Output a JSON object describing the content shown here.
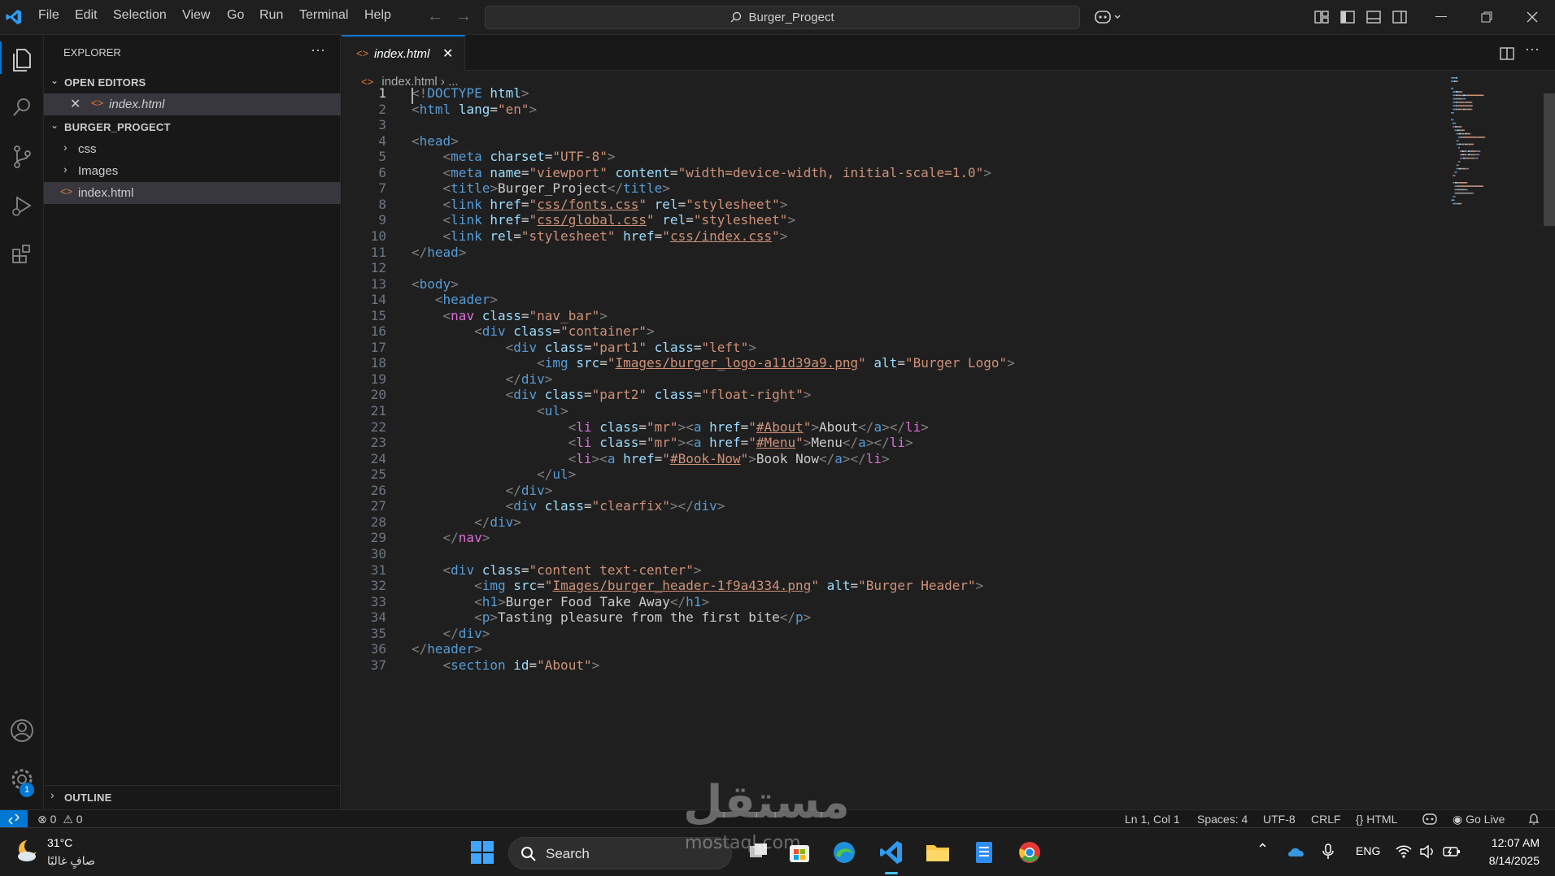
{
  "menu": [
    "File",
    "Edit",
    "Selection",
    "View",
    "Go",
    "Run",
    "Terminal",
    "Help"
  ],
  "search": {
    "label": "Burger_Progect"
  },
  "explorer": {
    "title": "EXPLORER",
    "open_editors_label": "OPEN EDITORS",
    "open_editor_file": "index.html",
    "project_label": "BURGER_PROGECT",
    "folders": [
      "css",
      "Images"
    ],
    "file": "index.html",
    "outline_label": "OUTLINE"
  },
  "tab": {
    "label": "index.html"
  },
  "breadcrumb": {
    "file": "index.html",
    "sep": "›",
    "more": "..."
  },
  "code": [
    [
      [
        "t",
        "<!"
      ],
      [
        "n",
        "DOCTYPE"
      ],
      [
        "x",
        " "
      ],
      [
        "a",
        "html"
      ],
      [
        "t",
        ">"
      ]
    ],
    [
      [
        "t",
        "<"
      ],
      [
        "n",
        "html"
      ],
      [
        "x",
        " "
      ],
      [
        "a",
        "lang"
      ],
      [
        "x",
        "="
      ],
      [
        "s",
        "\"en\""
      ],
      [
        "t",
        ">"
      ]
    ],
    [],
    [
      [
        "t",
        "<"
      ],
      [
        "n",
        "head"
      ],
      [
        "t",
        ">"
      ]
    ],
    [
      [
        "x",
        "    "
      ],
      [
        "t",
        "<"
      ],
      [
        "n",
        "meta"
      ],
      [
        "x",
        " "
      ],
      [
        "a",
        "charset"
      ],
      [
        "x",
        "="
      ],
      [
        "s",
        "\"UTF-8\""
      ],
      [
        "t",
        ">"
      ]
    ],
    [
      [
        "x",
        "    "
      ],
      [
        "t",
        "<"
      ],
      [
        "n",
        "meta"
      ],
      [
        "x",
        " "
      ],
      [
        "a",
        "name"
      ],
      [
        "x",
        "="
      ],
      [
        "s",
        "\"viewport\""
      ],
      [
        "x",
        " "
      ],
      [
        "a",
        "content"
      ],
      [
        "x",
        "="
      ],
      [
        "s",
        "\"width=device-width, initial-scale=1.0\""
      ],
      [
        "t",
        ">"
      ]
    ],
    [
      [
        "x",
        "    "
      ],
      [
        "t",
        "<"
      ],
      [
        "n",
        "title"
      ],
      [
        "t",
        ">"
      ],
      [
        "x",
        "Burger_Project"
      ],
      [
        "t",
        "</"
      ],
      [
        "n",
        "title"
      ],
      [
        "t",
        ">"
      ]
    ],
    [
      [
        "x",
        "    "
      ],
      [
        "t",
        "<"
      ],
      [
        "n",
        "link"
      ],
      [
        "x",
        " "
      ],
      [
        "a",
        "href"
      ],
      [
        "x",
        "="
      ],
      [
        "s",
        "\""
      ],
      [
        "su",
        "css/fonts.css"
      ],
      [
        "s",
        "\""
      ],
      [
        "x",
        " "
      ],
      [
        "a",
        "rel"
      ],
      [
        "x",
        "="
      ],
      [
        "s",
        "\"stylesheet\""
      ],
      [
        "t",
        ">"
      ]
    ],
    [
      [
        "x",
        "    "
      ],
      [
        "t",
        "<"
      ],
      [
        "n",
        "link"
      ],
      [
        "x",
        " "
      ],
      [
        "a",
        "href"
      ],
      [
        "x",
        "="
      ],
      [
        "s",
        "\""
      ],
      [
        "su",
        "css/global.css"
      ],
      [
        "s",
        "\""
      ],
      [
        "x",
        " "
      ],
      [
        "a",
        "rel"
      ],
      [
        "x",
        "="
      ],
      [
        "s",
        "\"stylesheet\""
      ],
      [
        "t",
        ">"
      ]
    ],
    [
      [
        "x",
        "    "
      ],
      [
        "t",
        "<"
      ],
      [
        "n",
        "link"
      ],
      [
        "x",
        " "
      ],
      [
        "a",
        "rel"
      ],
      [
        "x",
        "="
      ],
      [
        "s",
        "\"stylesheet\""
      ],
      [
        "x",
        " "
      ],
      [
        "a",
        "href"
      ],
      [
        "x",
        "="
      ],
      [
        "s",
        "\""
      ],
      [
        "su",
        "css/index.css"
      ],
      [
        "s",
        "\""
      ],
      [
        "t",
        ">"
      ]
    ],
    [
      [
        "t",
        "</"
      ],
      [
        "n",
        "head"
      ],
      [
        "t",
        ">"
      ]
    ],
    [],
    [
      [
        "t",
        "<"
      ],
      [
        "n",
        "body"
      ],
      [
        "t",
        ">"
      ]
    ],
    [
      [
        "x",
        "   "
      ],
      [
        "t",
        "<"
      ],
      [
        "n",
        "header"
      ],
      [
        "t",
        ">"
      ]
    ],
    [
      [
        "x",
        "    "
      ],
      [
        "t",
        "<"
      ],
      [
        "c1",
        "nav"
      ],
      [
        "x",
        " "
      ],
      [
        "a",
        "class"
      ],
      [
        "x",
        "="
      ],
      [
        "s",
        "\"nav_bar\""
      ],
      [
        "t",
        ">"
      ]
    ],
    [
      [
        "x",
        "        "
      ],
      [
        "t",
        "<"
      ],
      [
        "n",
        "div"
      ],
      [
        "x",
        " "
      ],
      [
        "a",
        "class"
      ],
      [
        "x",
        "="
      ],
      [
        "s",
        "\"container\""
      ],
      [
        "t",
        ">"
      ]
    ],
    [
      [
        "x",
        "            "
      ],
      [
        "t",
        "<"
      ],
      [
        "n",
        "div"
      ],
      [
        "x",
        " "
      ],
      [
        "a",
        "class"
      ],
      [
        "x",
        "="
      ],
      [
        "s",
        "\"part1\""
      ],
      [
        "x",
        " "
      ],
      [
        "a",
        "class"
      ],
      [
        "x",
        "="
      ],
      [
        "s",
        "\"left\""
      ],
      [
        "t",
        ">"
      ]
    ],
    [
      [
        "x",
        "                "
      ],
      [
        "t",
        "<"
      ],
      [
        "n",
        "img"
      ],
      [
        "x",
        " "
      ],
      [
        "a",
        "src"
      ],
      [
        "x",
        "="
      ],
      [
        "s",
        "\""
      ],
      [
        "su",
        "Images/burger_logo-a11d39a9.png"
      ],
      [
        "s",
        "\""
      ],
      [
        "x",
        " "
      ],
      [
        "a",
        "alt"
      ],
      [
        "x",
        "="
      ],
      [
        "s",
        "\"Burger Logo\""
      ],
      [
        "t",
        ">"
      ]
    ],
    [
      [
        "x",
        "            "
      ],
      [
        "t",
        "</"
      ],
      [
        "n",
        "div"
      ],
      [
        "t",
        ">"
      ]
    ],
    [
      [
        "x",
        "            "
      ],
      [
        "t",
        "<"
      ],
      [
        "n",
        "div"
      ],
      [
        "x",
        " "
      ],
      [
        "a",
        "class"
      ],
      [
        "x",
        "="
      ],
      [
        "s",
        "\"part2\""
      ],
      [
        "x",
        " "
      ],
      [
        "a",
        "class"
      ],
      [
        "x",
        "="
      ],
      [
        "s",
        "\"float-right\""
      ],
      [
        "t",
        ">"
      ]
    ],
    [
      [
        "x",
        "                "
      ],
      [
        "t",
        "<"
      ],
      [
        "n",
        "ul"
      ],
      [
        "t",
        ">"
      ]
    ],
    [
      [
        "x",
        "                    "
      ],
      [
        "t",
        "<"
      ],
      [
        "c1",
        "li"
      ],
      [
        "x",
        " "
      ],
      [
        "a",
        "class"
      ],
      [
        "x",
        "="
      ],
      [
        "s",
        "\"mr\""
      ],
      [
        "t",
        ">"
      ],
      [
        "t",
        "<"
      ],
      [
        "n",
        "a"
      ],
      [
        "x",
        " "
      ],
      [
        "a",
        "href"
      ],
      [
        "x",
        "="
      ],
      [
        "s",
        "\""
      ],
      [
        "su",
        "#About"
      ],
      [
        "s",
        "\""
      ],
      [
        "t",
        ">"
      ],
      [
        "x",
        "About"
      ],
      [
        "t",
        "</"
      ],
      [
        "n",
        "a"
      ],
      [
        "t",
        "></"
      ],
      [
        "c1",
        "li"
      ],
      [
        "t",
        ">"
      ]
    ],
    [
      [
        "x",
        "                    "
      ],
      [
        "t",
        "<"
      ],
      [
        "c1",
        "li"
      ],
      [
        "x",
        " "
      ],
      [
        "a",
        "class"
      ],
      [
        "x",
        "="
      ],
      [
        "s",
        "\"mr\""
      ],
      [
        "t",
        ">"
      ],
      [
        "t",
        "<"
      ],
      [
        "n",
        "a"
      ],
      [
        "x",
        " "
      ],
      [
        "a",
        "href"
      ],
      [
        "x",
        "="
      ],
      [
        "s",
        "\""
      ],
      [
        "su",
        "#Menu"
      ],
      [
        "s",
        "\""
      ],
      [
        "t",
        ">"
      ],
      [
        "x",
        "Menu"
      ],
      [
        "t",
        "</"
      ],
      [
        "n",
        "a"
      ],
      [
        "t",
        "></"
      ],
      [
        "c1",
        "li"
      ],
      [
        "t",
        ">"
      ]
    ],
    [
      [
        "x",
        "                    "
      ],
      [
        "t",
        "<"
      ],
      [
        "c1",
        "li"
      ],
      [
        "t",
        ">"
      ],
      [
        "t",
        "<"
      ],
      [
        "n",
        "a"
      ],
      [
        "x",
        " "
      ],
      [
        "a",
        "href"
      ],
      [
        "x",
        "="
      ],
      [
        "s",
        "\""
      ],
      [
        "su",
        "#Book-Now"
      ],
      [
        "s",
        "\""
      ],
      [
        "t",
        ">"
      ],
      [
        "x",
        "Book Now"
      ],
      [
        "t",
        "</"
      ],
      [
        "n",
        "a"
      ],
      [
        "t",
        "></"
      ],
      [
        "c1",
        "li"
      ],
      [
        "t",
        ">"
      ]
    ],
    [
      [
        "x",
        "                "
      ],
      [
        "t",
        "</"
      ],
      [
        "n",
        "ul"
      ],
      [
        "t",
        ">"
      ]
    ],
    [
      [
        "x",
        "            "
      ],
      [
        "t",
        "</"
      ],
      [
        "n",
        "div"
      ],
      [
        "t",
        ">"
      ]
    ],
    [
      [
        "x",
        "            "
      ],
      [
        "t",
        "<"
      ],
      [
        "n",
        "div"
      ],
      [
        "x",
        " "
      ],
      [
        "a",
        "class"
      ],
      [
        "x",
        "="
      ],
      [
        "s",
        "\"clearfix\""
      ],
      [
        "t",
        "></"
      ],
      [
        "n",
        "div"
      ],
      [
        "t",
        ">"
      ]
    ],
    [
      [
        "x",
        "        "
      ],
      [
        "t",
        "</"
      ],
      [
        "n",
        "div"
      ],
      [
        "t",
        ">"
      ]
    ],
    [
      [
        "x",
        "    "
      ],
      [
        "t",
        "</"
      ],
      [
        "c1",
        "nav"
      ],
      [
        "t",
        ">"
      ]
    ],
    [],
    [
      [
        "x",
        "    "
      ],
      [
        "t",
        "<"
      ],
      [
        "n",
        "div"
      ],
      [
        "x",
        " "
      ],
      [
        "a",
        "class"
      ],
      [
        "x",
        "="
      ],
      [
        "s",
        "\"content text-center\""
      ],
      [
        "t",
        ">"
      ]
    ],
    [
      [
        "x",
        "        "
      ],
      [
        "t",
        "<"
      ],
      [
        "n",
        "img"
      ],
      [
        "x",
        " "
      ],
      [
        "a",
        "src"
      ],
      [
        "x",
        "="
      ],
      [
        "s",
        "\""
      ],
      [
        "su",
        "Images/burger_header-1f9a4334.png"
      ],
      [
        "s",
        "\""
      ],
      [
        "x",
        " "
      ],
      [
        "a",
        "alt"
      ],
      [
        "x",
        "="
      ],
      [
        "s",
        "\"Burger Header\""
      ],
      [
        "t",
        ">"
      ]
    ],
    [
      [
        "x",
        "        "
      ],
      [
        "t",
        "<"
      ],
      [
        "n",
        "h1"
      ],
      [
        "t",
        ">"
      ],
      [
        "x",
        "Burger Food Take Away"
      ],
      [
        "t",
        "</"
      ],
      [
        "n",
        "h1"
      ],
      [
        "t",
        ">"
      ]
    ],
    [
      [
        "x",
        "        "
      ],
      [
        "t",
        "<"
      ],
      [
        "n",
        "p"
      ],
      [
        "t",
        ">"
      ],
      [
        "x",
        "Tasting pleasure from the first bite"
      ],
      [
        "t",
        "</"
      ],
      [
        "n",
        "p"
      ],
      [
        "t",
        ">"
      ]
    ],
    [
      [
        "x",
        "    "
      ],
      [
        "t",
        "</"
      ],
      [
        "n",
        "div"
      ],
      [
        "t",
        ">"
      ]
    ],
    [
      [
        "t",
        "</"
      ],
      [
        "n",
        "header"
      ],
      [
        "t",
        ">"
      ]
    ],
    [
      [
        "x",
        "    "
      ],
      [
        "t",
        "<"
      ],
      [
        "n",
        "section"
      ],
      [
        "x",
        " "
      ],
      [
        "a",
        "id"
      ],
      [
        "x",
        "="
      ],
      [
        "s",
        "\"About\""
      ],
      [
        "t",
        ">"
      ]
    ]
  ],
  "status": {
    "errors": "0",
    "warnings": "0",
    "position": "Ln 1, Col 1",
    "spaces": "Spaces: 4",
    "encoding": "UTF-8",
    "eol": "CRLF",
    "language": "HTML",
    "golive": "Go Live"
  },
  "taskbar": {
    "temp": "31°C",
    "weather": "صافٍ غالبًا",
    "search": "Search",
    "lang": "ENG",
    "time": "12:07 AM",
    "date": "8/14/2025"
  },
  "watermark": {
    "main": "مستقل",
    "sub": "mostaql.com"
  },
  "colors": {
    "accent": "#0078d4",
    "tag": "#569cd6",
    "attr": "#9cdcfe",
    "string": "#ce9178",
    "bracket_purple": "#da70d6"
  }
}
